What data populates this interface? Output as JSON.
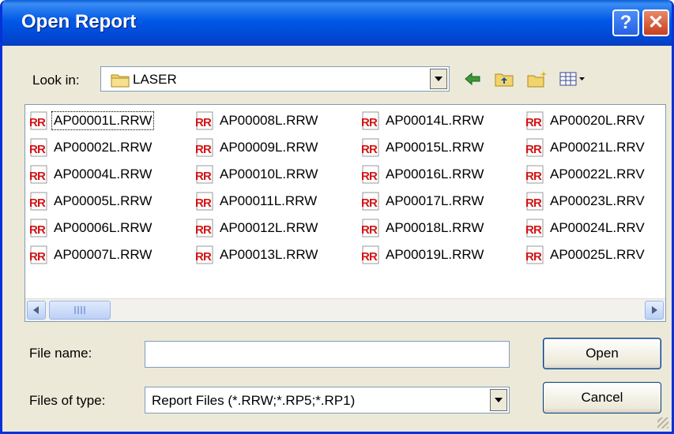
{
  "window": {
    "title": "Open Report"
  },
  "look_in": {
    "label": "Look in:",
    "value": "LASER",
    "icon": "folder-icon"
  },
  "toolbar": [
    {
      "name": "back-icon"
    },
    {
      "name": "up-folder-icon"
    },
    {
      "name": "new-folder-icon"
    },
    {
      "name": "view-menu-icon"
    }
  ],
  "files": {
    "icon": "rrw-report-icon",
    "columns": [
      [
        "AP00001L.RRW",
        "AP00002L.RRW",
        "AP00004L.RRW",
        "AP00005L.RRW",
        "AP00006L.RRW",
        "AP00007L.RRW"
      ],
      [
        "AP00008L.RRW",
        "AP00009L.RRW",
        "AP00010L.RRW",
        "AP00011L.RRW",
        "AP00012L.RRW",
        "AP00013L.RRW"
      ],
      [
        "AP00014L.RRW",
        "AP00015L.RRW",
        "AP00016L.RRW",
        "AP00017L.RRW",
        "AP00018L.RRW",
        "AP00019L.RRW"
      ],
      [
        "AP00020L.RRV",
        "AP00021L.RRV",
        "AP00022L.RRV",
        "AP00023L.RRV",
        "AP00024L.RRV",
        "AP00025L.RRV"
      ]
    ],
    "focused": "AP00001L.RRW"
  },
  "file_name": {
    "label": "File name:",
    "value": ""
  },
  "file_type": {
    "label": "Files of type:",
    "value": "Report Files (*.RRW;*.RP5;*.RP1)"
  },
  "buttons": {
    "open": "Open",
    "cancel": "Cancel"
  },
  "colors": {
    "titlebar": "#0058e6",
    "dialog_bg": "#ece9d8",
    "field_border": "#7f9db9"
  }
}
